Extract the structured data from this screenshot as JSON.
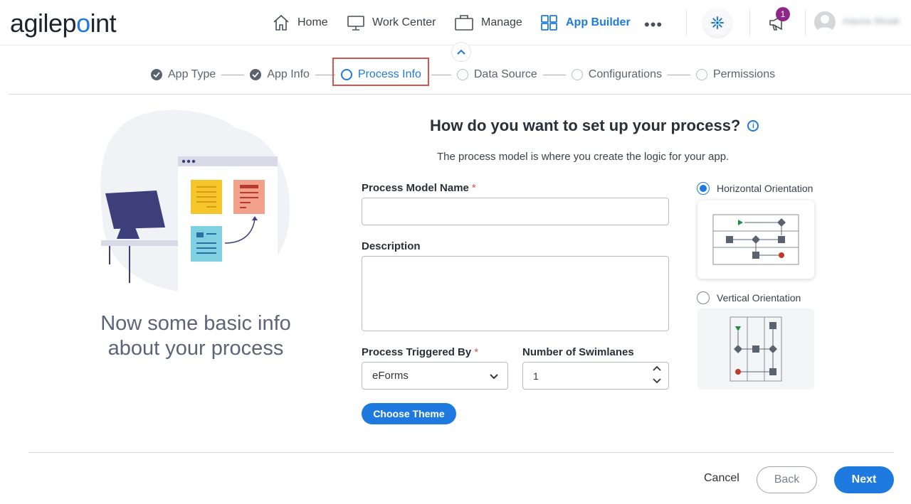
{
  "brand": {
    "logo_prefix": "agilep",
    "logo_dot": "o",
    "logo_suffix": "int"
  },
  "nav": {
    "home": "Home",
    "work_center": "Work Center",
    "manage": "Manage",
    "app_builder": "App Builder",
    "more": "•••",
    "notification_count": "1",
    "username": "mauna Shoak"
  },
  "steps": [
    {
      "label": "App Type",
      "state": "done"
    },
    {
      "label": "App Info",
      "state": "done"
    },
    {
      "label": "Process Info",
      "state": "current"
    },
    {
      "label": "Data Source",
      "state": "todo"
    },
    {
      "label": "Configurations",
      "state": "todo"
    },
    {
      "label": "Permissions",
      "state": "todo"
    }
  ],
  "illustration": {
    "tagline": "Now some basic info about your process"
  },
  "form": {
    "title": "How do you want to set up your process?",
    "subtitle": "The process model is where you create the logic for your app.",
    "process_model_name_label": "Process Model Name",
    "process_model_name_value": "",
    "required_mark": "*",
    "description_label": "Description",
    "description_value": "",
    "triggered_by_label": "Process Triggered By",
    "triggered_by_value": "eForms",
    "swimlanes_label": "Number of Swimlanes",
    "swimlanes_value": "1",
    "choose_theme": "Choose Theme"
  },
  "orientation": {
    "horizontal_label": "Horizontal Orientation",
    "vertical_label": "Vertical Orientation",
    "selected": "horizontal"
  },
  "footer": {
    "cancel": "Cancel",
    "back": "Back",
    "next": "Next"
  },
  "colors": {
    "accent": "#1f7ae0",
    "required": "#d9534f",
    "badge": "#8e2787"
  }
}
